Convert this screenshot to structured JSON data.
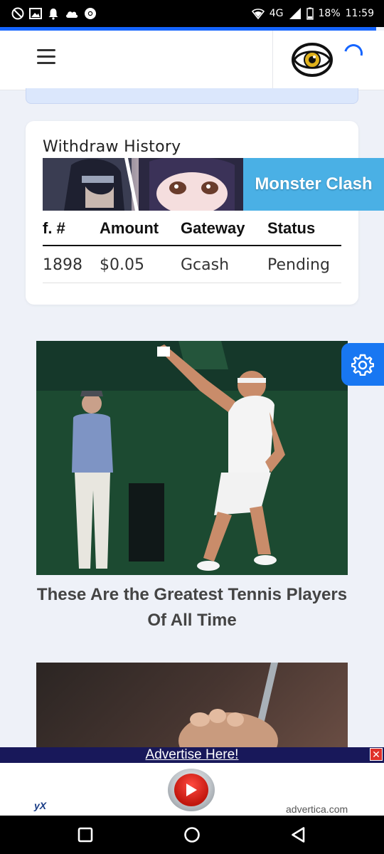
{
  "status_bar": {
    "network": "4G",
    "battery": "18%",
    "time": "11:59"
  },
  "page_progress": 0.98,
  "withdraw": {
    "title": "Withdraw History",
    "banner_text": "Monster Clash",
    "columns": [
      "f. #",
      "Amount",
      "Gateway",
      "Status"
    ],
    "rows": [
      [
        "1898",
        "$0.05",
        "Gcash",
        "Pending"
      ]
    ]
  },
  "article": {
    "title": "These Are the Greatest Tennis Players Of All Time"
  },
  "ad": {
    "link_text": "Advertise Here!",
    "close_label": "✕",
    "logo_text": "yX",
    "domain": "advertica.com"
  },
  "colors": {
    "accent": "#1565ff",
    "pending": "#1b3fd6",
    "settings": "#1877f2",
    "banner": "#4ab0e5"
  }
}
